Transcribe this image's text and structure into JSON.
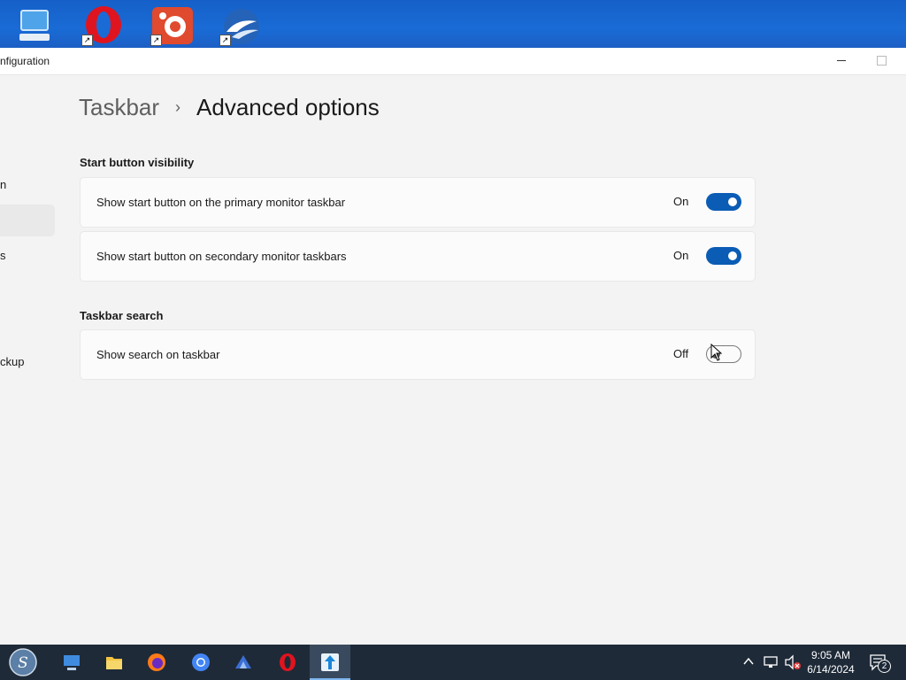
{
  "window": {
    "title": "nfiguration",
    "buttons": {
      "minimize": "minimize",
      "maximize": "maximize"
    }
  },
  "sidebar": {
    "items": [
      {
        "label": "n"
      },
      {
        "label": "s"
      },
      {
        "label": "ckup"
      }
    ]
  },
  "breadcrumb": {
    "parent": "Taskbar",
    "separator": "›",
    "current": "Advanced options"
  },
  "sections": [
    {
      "title": "Start button visibility",
      "settings": [
        {
          "label": "Show start button on the primary monitor taskbar",
          "state_label": "On",
          "enabled": true
        },
        {
          "label": "Show start button on secondary monitor taskbars",
          "state_label": "On",
          "enabled": true
        }
      ]
    },
    {
      "title": "Taskbar search",
      "settings": [
        {
          "label": "Show search on taskbar",
          "state_label": "Off",
          "enabled": false
        }
      ]
    }
  ],
  "desktop_icons": [
    "computer-icon",
    "opera-icon",
    "gimp-icon",
    "openoffice-icon"
  ],
  "taskbar": {
    "apps": [
      "start-orb-icon",
      "desktop-icon",
      "file-explorer-icon",
      "firefox-icon",
      "chrome-icon",
      "bird-app-icon",
      "opera-icon",
      "settings-app-icon"
    ],
    "clock": {
      "time": "9:05 AM",
      "date": "6/14/2024"
    },
    "notification_count": "2"
  },
  "colors": {
    "accent": "#0a5cb5",
    "window_bg": "#f3f3f3",
    "taskbar_bg": "#1e2a38",
    "desktop_bg": "#1a6bd6"
  }
}
